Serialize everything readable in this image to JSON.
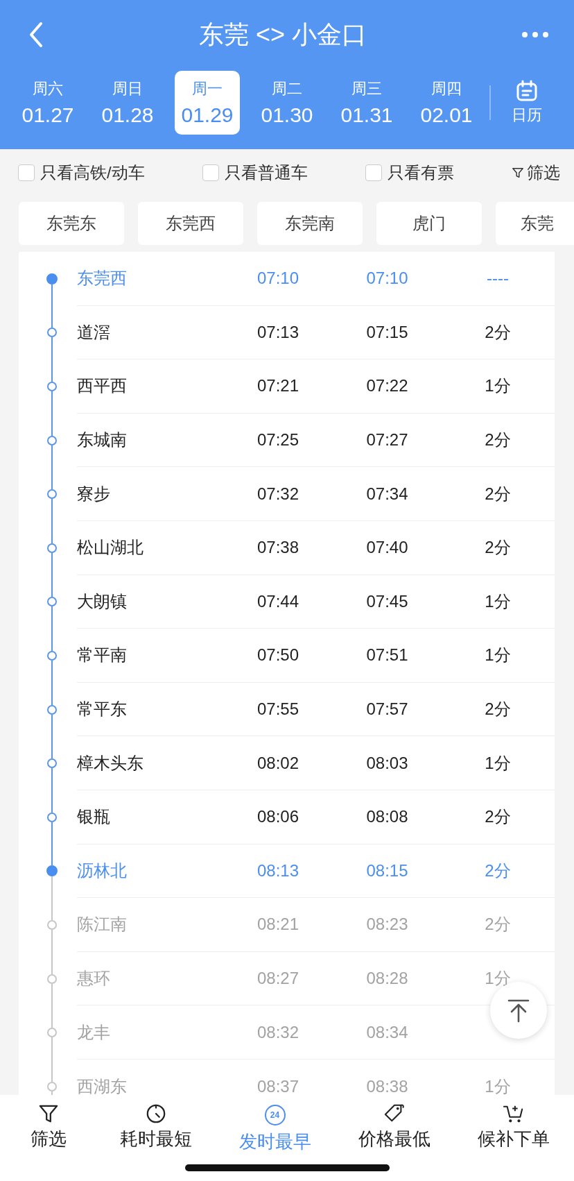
{
  "header": {
    "title": "东莞 <> 小金口"
  },
  "dates": [
    {
      "weekday": "周六",
      "date": "01.27",
      "selected": false
    },
    {
      "weekday": "周日",
      "date": "01.28",
      "selected": false
    },
    {
      "weekday": "周一",
      "date": "01.29",
      "selected": true
    },
    {
      "weekday": "周二",
      "date": "01.30",
      "selected": false
    },
    {
      "weekday": "周三",
      "date": "01.31",
      "selected": false
    },
    {
      "weekday": "周四",
      "date": "02.01",
      "selected": false
    }
  ],
  "calendar": {
    "label": "日历"
  },
  "filters": [
    {
      "label": "只看高铁/动车",
      "checked": false
    },
    {
      "label": "只看普通车",
      "checked": false
    },
    {
      "label": "只看有票",
      "checked": false
    }
  ],
  "filter_button": {
    "label": "筛选"
  },
  "stations": [
    "东莞东",
    "东莞西",
    "东莞南",
    "虎门",
    "东莞"
  ],
  "stops": [
    {
      "name": "东莞西",
      "arrive": "07:10",
      "depart": "07:10",
      "stay": "----",
      "kind": "terminal"
    },
    {
      "name": "道滘",
      "arrive": "07:13",
      "depart": "07:15",
      "stay": "2分",
      "kind": "stop"
    },
    {
      "name": "西平西",
      "arrive": "07:21",
      "depart": "07:22",
      "stay": "1分",
      "kind": "stop"
    },
    {
      "name": "东城南",
      "arrive": "07:25",
      "depart": "07:27",
      "stay": "2分",
      "kind": "stop"
    },
    {
      "name": "寮步",
      "arrive": "07:32",
      "depart": "07:34",
      "stay": "2分",
      "kind": "stop"
    },
    {
      "name": "松山湖北",
      "arrive": "07:38",
      "depart": "07:40",
      "stay": "2分",
      "kind": "stop"
    },
    {
      "name": "大朗镇",
      "arrive": "07:44",
      "depart": "07:45",
      "stay": "1分",
      "kind": "stop"
    },
    {
      "name": "常平南",
      "arrive": "07:50",
      "depart": "07:51",
      "stay": "1分",
      "kind": "stop"
    },
    {
      "name": "常平东",
      "arrive": "07:55",
      "depart": "07:57",
      "stay": "2分",
      "kind": "stop"
    },
    {
      "name": "樟木头东",
      "arrive": "08:02",
      "depart": "08:03",
      "stay": "1分",
      "kind": "stop"
    },
    {
      "name": "银瓶",
      "arrive": "08:06",
      "depart": "08:08",
      "stay": "2分",
      "kind": "stop"
    },
    {
      "name": "沥林北",
      "arrive": "08:13",
      "depart": "08:15",
      "stay": "2分",
      "kind": "terminal"
    },
    {
      "name": "陈江南",
      "arrive": "08:21",
      "depart": "08:23",
      "stay": "2分",
      "kind": "beyond"
    },
    {
      "name": "惠环",
      "arrive": "08:27",
      "depart": "08:28",
      "stay": "1分",
      "kind": "beyond"
    },
    {
      "name": "龙丰",
      "arrive": "08:32",
      "depart": "08:34",
      "kind": "beyond"
    },
    {
      "name": "西湖东",
      "arrive": "08:37",
      "depart": "08:38",
      "stay": "1分",
      "kind": "beyond"
    }
  ],
  "tabbar": [
    {
      "label": "筛选",
      "kind": "filter",
      "selected": false
    },
    {
      "label": "耗时最短",
      "kind": "duration",
      "selected": false
    },
    {
      "label": "发时最早",
      "kind": "earliest",
      "icon_text": "24",
      "selected": true
    },
    {
      "label": "价格最低",
      "kind": "price",
      "selected": false
    },
    {
      "label": "候补下单",
      "kind": "waitlist",
      "selected": false
    }
  ]
}
